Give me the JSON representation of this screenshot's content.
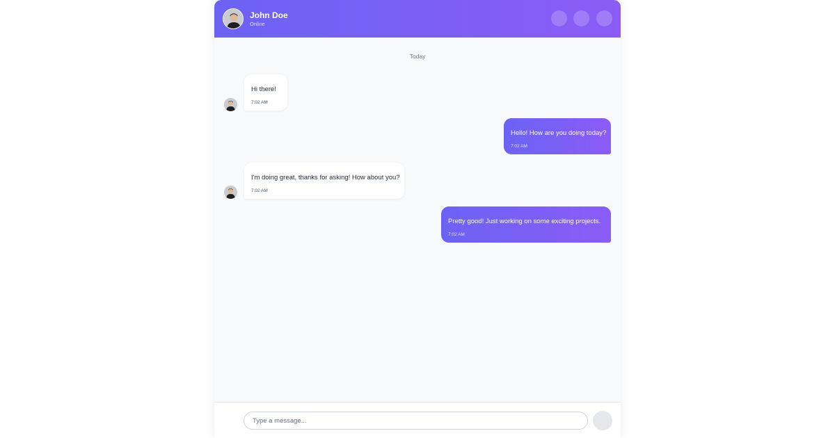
{
  "header": {
    "name": "John Doe",
    "status": "Online",
    "actions": [
      {
        "icon": "phone-icon"
      },
      {
        "icon": "video-icon"
      },
      {
        "icon": "more-icon"
      }
    ]
  },
  "date_divider": "Today",
  "messages": [
    {
      "direction": "incoming",
      "text": "Hi there! ",
      "time": "7:02 AM"
    },
    {
      "direction": "outgoing",
      "text": "Hello! How are you doing today?",
      "time": "7:02 AM"
    },
    {
      "direction": "incoming",
      "text": "I'm doing great, thanks for asking! How about you?",
      "time": "7:02 AM"
    },
    {
      "direction": "outgoing",
      "text": "Pretty good! Just working on some exciting projects. ",
      "time": "7:02 AM"
    }
  ],
  "composer": {
    "placeholder": "Type a message...",
    "send_icon": "send-icon"
  },
  "colors": {
    "accent_start": "#6b63f4",
    "accent_end": "#8b5cf6",
    "background": "#f8f9fb"
  }
}
